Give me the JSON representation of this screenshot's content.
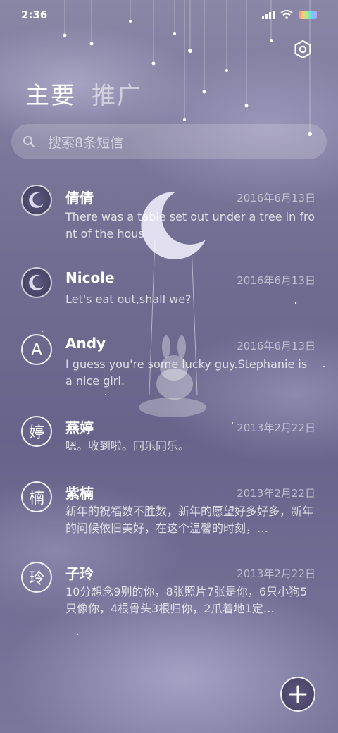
{
  "status_bar": {
    "time": "2:36",
    "icons": [
      "signal-icon",
      "wifi-icon",
      "battery-icon"
    ]
  },
  "header": {
    "settings_icon": "gear-icon"
  },
  "tabs": [
    {
      "label": "主要",
      "active": true
    },
    {
      "label": "推广",
      "active": false
    }
  ],
  "search": {
    "placeholder": "搜索8条短信"
  },
  "conversations": [
    {
      "avatar_type": "image",
      "avatar": "moon-avatar",
      "name": "倩倩",
      "date": "2016年6月13日",
      "preview": "There was a table set out under a tree in front of the hous"
    },
    {
      "avatar_type": "image",
      "avatar": "moon-avatar",
      "name": "Nicole",
      "date": "2016年6月13日",
      "preview": "Let's eat out,shall we?"
    },
    {
      "avatar_type": "letter",
      "avatar": "A",
      "name": "Andy",
      "date": "2016年6月13日",
      "preview": "I guess you're some lucky guy.Stephanie is a nice girl."
    },
    {
      "avatar_type": "letter",
      "avatar": "婷",
      "name": "燕婷",
      "date": "2013年2月22日",
      "preview": "嗯。收到啦。同乐同乐。"
    },
    {
      "avatar_type": "letter",
      "avatar": "楠",
      "name": "紫楠",
      "date": "2013年2月22日",
      "preview": "新年的祝福数不胜数，新年的愿望好多好多，新年的问候依旧美好，在这个温馨的时刻，…"
    },
    {
      "avatar_type": "letter",
      "avatar": "玲",
      "name": "子玲",
      "date": "2013年2月22日",
      "preview": "10分想念9别的你，8张照片7张是你，6只小狗5只像你，4根骨头3根归你，2爪着地1定…"
    }
  ],
  "fab": {
    "icon": "plus-icon"
  },
  "colors": {
    "background": "#716d92",
    "text": "#ffffff",
    "secondary_text": "#c8c5d8"
  }
}
